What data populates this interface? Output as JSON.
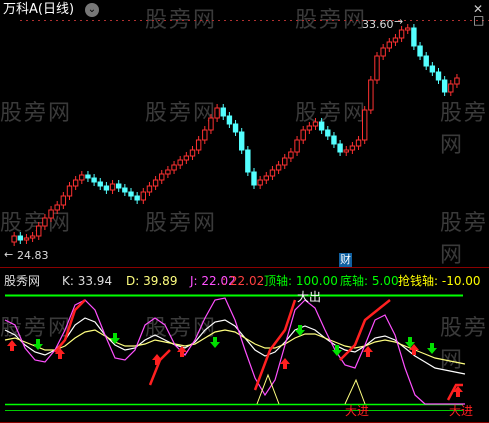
{
  "header": {
    "title": "万科A(日线)",
    "dropdown_icon": "chevron-down-icon",
    "close_icon": "close-icon",
    "maximize_icon": "maximize-icon"
  },
  "price_chart": {
    "high_label": "33.60",
    "low_label": "24.83",
    "finance_marker": "财"
  },
  "indicator": {
    "name": "股秀网",
    "k_label": "K: 33.94",
    "d_label": "D: 39.89",
    "j_label": "J: 22.02",
    "extra_value": ": 22.02",
    "top_axis": "顶轴: 100.00",
    "bottom_axis": "底轴: 5.00",
    "grab_axis": "抢钱轴: -10.00",
    "signal_out": "大出",
    "signal_in": "大进"
  },
  "watermarks": [
    "股旁网",
    "股旁网",
    "股旁网",
    "股旁网",
    "股旁网",
    "股旁网",
    "股旁网",
    "股旁网",
    "股旁网",
    "股旁网",
    "股旁网",
    "股旁网"
  ],
  "colors": {
    "bull": "#ff3232",
    "bear": "#54ffff",
    "k_line": "#ffffff",
    "d_line": "#ffff80",
    "j_line": "#ff50ff",
    "axis_line": "#00ff00",
    "signal_up": "#ff2020",
    "signal_down": "#00e000",
    "label_yellow": "#ffff00",
    "label_green": "#00ff00",
    "label_magenta": "#ff50ff",
    "label_red": "#ff4040"
  }
}
